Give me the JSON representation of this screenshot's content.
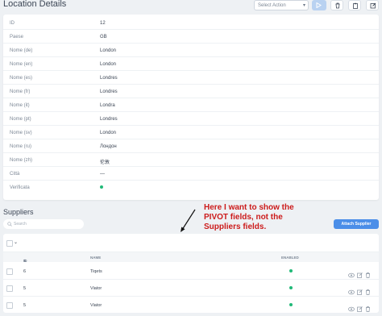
{
  "header": {
    "title": "Location Details",
    "select_action_placeholder": "Select Action"
  },
  "details": [
    {
      "label": "ID",
      "value": "12"
    },
    {
      "label": "Paese",
      "value": "GB"
    },
    {
      "label": "Nome (de)",
      "value": "London"
    },
    {
      "label": "Nome (en)",
      "value": "London"
    },
    {
      "label": "Nome (es)",
      "value": "Londres"
    },
    {
      "label": "Nome (fr)",
      "value": "Londres"
    },
    {
      "label": "Nome (it)",
      "value": "Londra"
    },
    {
      "label": "Nome (pt)",
      "value": "Londres"
    },
    {
      "label": "Nome (sv)",
      "value": "London"
    },
    {
      "label": "Nome (ru)",
      "value": "Лондон"
    },
    {
      "label": "Nome (zh)",
      "value": "伦敦"
    },
    {
      "label": "Città",
      "value": "—"
    },
    {
      "label": "Verificata",
      "value": ""
    }
  ],
  "annotation": "Here I want to show the PIVOT fields, not the Suppliers fields.",
  "suppliers": {
    "title": "Suppliers",
    "search_placeholder": "Search",
    "attach_label": "Attach Supplier",
    "columns": {
      "id": "ID",
      "name": "NAME",
      "enabled": "ENABLED"
    },
    "rows": [
      {
        "id": "6",
        "name": "Tiqets",
        "enabled": true
      },
      {
        "id": "5",
        "name": "Viator",
        "enabled": true
      },
      {
        "id": "5",
        "name": "Viator",
        "enabled": true
      }
    ]
  },
  "colors": {
    "accent": "#4b8ee8",
    "enabled_dot": "#21b978",
    "annotation": "#cc1b1b"
  }
}
